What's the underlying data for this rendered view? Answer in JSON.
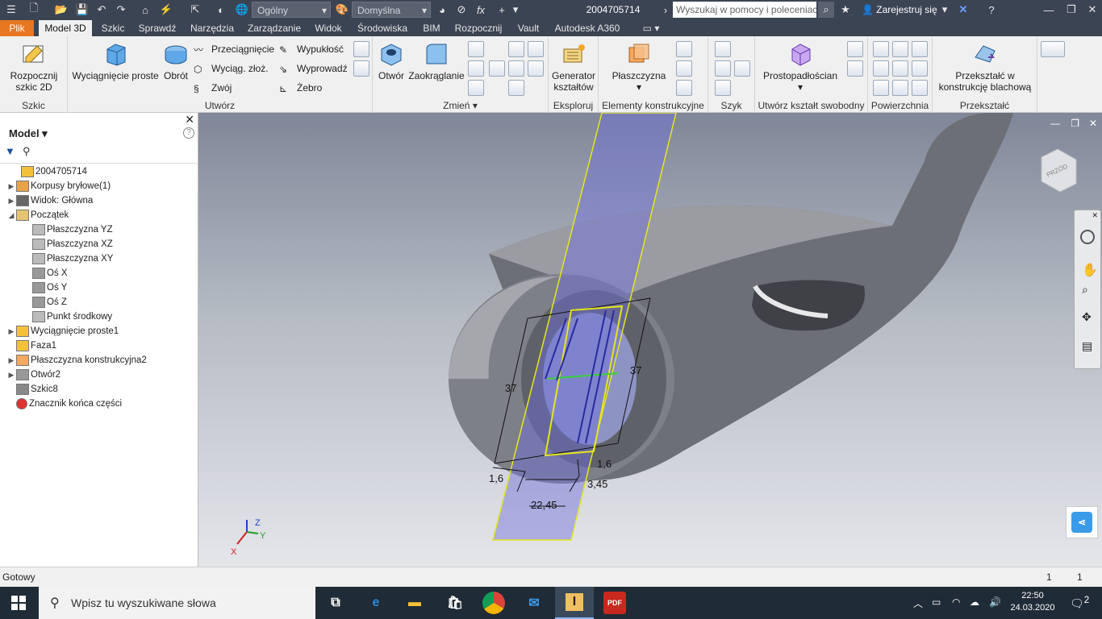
{
  "titlebar": {
    "material": "Ogólny",
    "appearance": "Domyślna",
    "document": "2004705714",
    "search_placeholder": "Wyszukaj w pomocy i poleceniach",
    "signin": "Zarejestruj się",
    "fx": "fx"
  },
  "tabs": [
    "Plik",
    "Model 3D",
    "Szkic",
    "Sprawdź",
    "Narzędzia",
    "Zarządzanie",
    "Widok",
    "Środowiska",
    "BIM",
    "Rozpocznij",
    "Vault",
    "Autodesk A360"
  ],
  "ribbon": {
    "sketch": {
      "start_sketch": "Rozpocznij szkic 2D",
      "group": "Szkic"
    },
    "create": {
      "extrude": "Wyciągnięcie proste",
      "revolve": "Obrót",
      "sweep": "Przeciągnięcie",
      "loft": "Wyciąg. złoż.",
      "coil": "Zwój",
      "emboss": "Wypukłość",
      "derive": "Wyprowadź",
      "rib": "Żebro",
      "group": "Utwórz"
    },
    "modify": {
      "hole": "Otwór",
      "fillet": "Zaokrąglanie",
      "group": "Zmień"
    },
    "explore": {
      "shape_generator": "Generator kształtów",
      "group": "Eksploruj"
    },
    "work_features": {
      "plane": "Płaszczyzna",
      "group": "Elementy konstrukcyjne"
    },
    "pattern": {
      "group": "Szyk"
    },
    "freeform": {
      "box": "Prostopadłościan",
      "group": "Utwórz kształt swobodny"
    },
    "surface": {
      "group": "Powierzchnia"
    },
    "convert": {
      "sheet_metal": "Przekształć w konstrukcję blachową",
      "group": "Przekształć"
    }
  },
  "browser": {
    "title": "Model",
    "items": [
      {
        "label": "2004705714",
        "icon": "part-icon",
        "indent": 0,
        "expander": ""
      },
      {
        "label": "Korpusy bryłowe(1)",
        "icon": "solid-bodies-icon",
        "indent": 1,
        "expander": "▶"
      },
      {
        "label": "Widok: Główna",
        "icon": "view-icon",
        "indent": 1,
        "expander": "▶"
      },
      {
        "label": "Początek",
        "icon": "folder-icon",
        "indent": 1,
        "expander": "◢"
      },
      {
        "label": "Płaszczyzna YZ",
        "icon": "plane-icon",
        "indent": 2,
        "expander": ""
      },
      {
        "label": "Płaszczyzna XZ",
        "icon": "plane-icon",
        "indent": 2,
        "expander": ""
      },
      {
        "label": "Płaszczyzna XY",
        "icon": "plane-icon",
        "indent": 2,
        "expander": ""
      },
      {
        "label": "Oś X",
        "icon": "axis-icon",
        "indent": 2,
        "expander": ""
      },
      {
        "label": "Oś Y",
        "icon": "axis-icon",
        "indent": 2,
        "expander": ""
      },
      {
        "label": "Oś Z",
        "icon": "axis-icon",
        "indent": 2,
        "expander": ""
      },
      {
        "label": "Punkt środkowy",
        "icon": "point-icon",
        "indent": 2,
        "expander": ""
      },
      {
        "label": "Wyciągnięcie proste1",
        "icon": "extrude-icon",
        "indent": 1,
        "expander": "▶"
      },
      {
        "label": "Faza1",
        "icon": "chamfer-icon",
        "indent": 1,
        "expander": ""
      },
      {
        "label": "Płaszczyzna konstrukcyjna2",
        "icon": "work-plane-icon",
        "indent": 1,
        "expander": "▶"
      },
      {
        "label": "Otwór2",
        "icon": "hole-icon",
        "indent": 1,
        "expander": "▶"
      },
      {
        "label": "Szkic8",
        "icon": "sketch-icon",
        "indent": 1,
        "expander": ""
      },
      {
        "label": "Znacznik końca części",
        "icon": "end-of-part-icon",
        "indent": 1,
        "expander": ""
      }
    ]
  },
  "viewport": {
    "viewcube_label": "PRZÓD",
    "dimensions": {
      "left_height": "37",
      "right_height": "37",
      "left_offset": "1,6",
      "right_offset": "1,6",
      "width": "22,45",
      "thickness": "3,45"
    },
    "axes": {
      "x": "X",
      "y": "Y",
      "z": "Z"
    }
  },
  "status": {
    "text": "Gotowy",
    "count1": "1",
    "count2": "1"
  },
  "taskbar": {
    "search_placeholder": "Wpisz tu wyszukiwane słowa",
    "time": "22:50",
    "date": "24.03.2020",
    "notifications": "2",
    "pdf_label": "PDF"
  }
}
